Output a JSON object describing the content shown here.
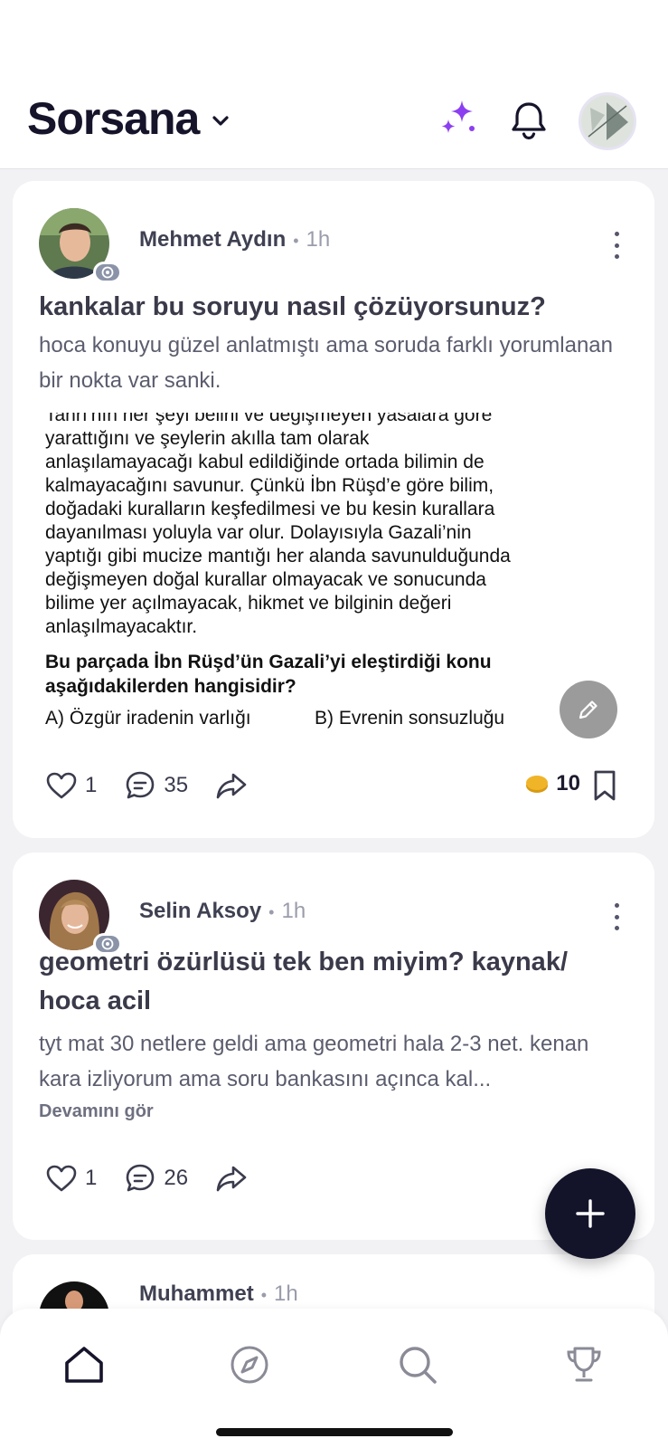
{
  "header": {
    "title": "Sorsana",
    "accent": "#8b3ff0"
  },
  "posts": [
    {
      "author": "Mehmet Aydın",
      "time": "1h",
      "title": "kankalar bu soruyu nasıl çözüyorsunuz?",
      "body": "hoca konuyu güzel anlatmıştı ama soruda farklı yorumlanan bir nokta var sanki.",
      "image": {
        "passage": "Tanrı'nın her şeyi belirli ve değişmeyen yasalara göre\nyarattığını ve şeylerin akılla tam olarak\nanlaşılamayacağı kabul edildiğinde ortada bilimin de\nkalmayacağını savunur. Çünkü İbn Rüşd’e göre bilim,\ndoğadaki kuralların keşfedilmesi ve bu kesin kurallara\ndayanılması yoluyla var olur. Dolayısıyla Gazali’nin\nyaptığı gibi mucize mantığı her alanda savunulduğunda\ndeğişmeyen doğal kurallar olmayacak ve sonucunda\nbilime yer açılmayacak, hikmet ve bilginin değeri\nanlaşılmayacaktır.",
        "question": "Bu parçada İbn Rüşd’ün Gazali’yi eleştirdiği konu\naşağıdakilerden hangisidir?",
        "option_a": "A) Özgür iradenin varlığı",
        "option_b": "B) Evrenin sonsuzluğu"
      },
      "likes": "1",
      "comments": "35",
      "coins": "10"
    },
    {
      "author": "Selin Aksoy",
      "time": "1h",
      "title": "geometri özürlüsü tek ben miyim? kaynak/ hoca acil",
      "body": "tyt mat 30 netlere geldi ama geometri hala 2-3 net. kenan kara izliyorum ama soru bankasını açınca kal...",
      "see_more": "Devamını gör",
      "likes": "1",
      "comments": "26"
    },
    {
      "author": "Muhammet",
      "time": "1h"
    }
  ],
  "icons": {
    "sparkle": "sparkle-icon",
    "bell": "bell-icon",
    "heart": "heart-icon",
    "comment": "comment-icon",
    "share": "share-icon",
    "coin": "coin-icon",
    "bookmark": "bookmark-icon",
    "edit": "pencil-icon",
    "plus": "plus-icon",
    "home": "home-icon",
    "explore": "compass-icon",
    "search": "search-icon",
    "leaderboard": "trophy-icon"
  },
  "colors": {
    "coin": "#f0b429",
    "fab": "#13142a",
    "brand_text": "#15142a"
  }
}
